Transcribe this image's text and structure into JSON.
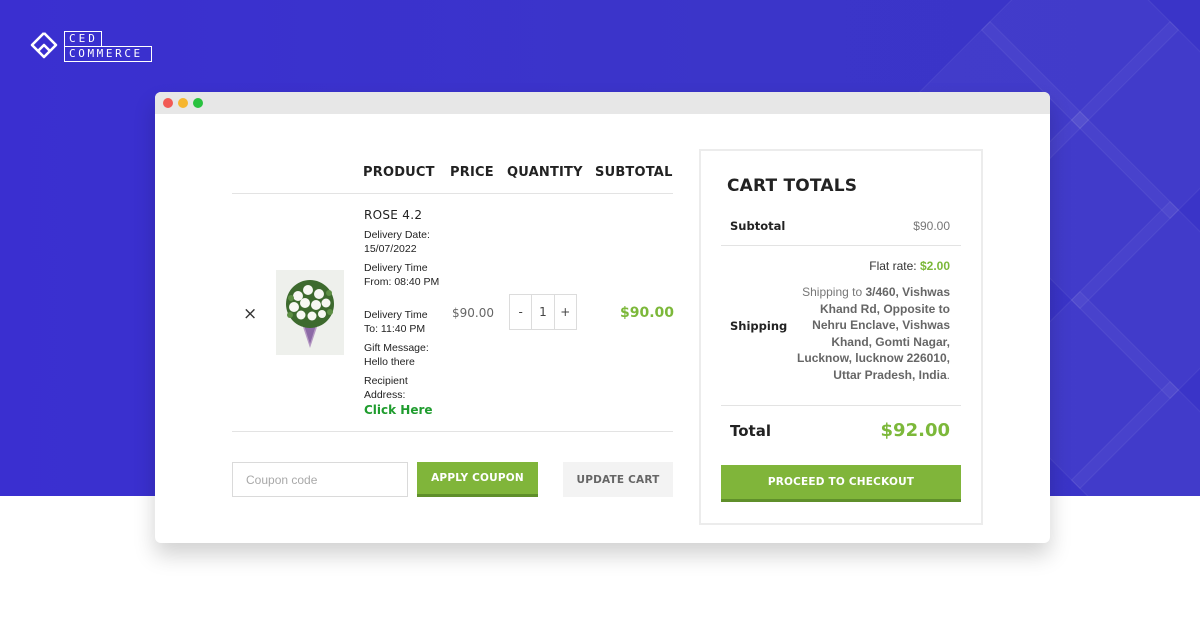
{
  "brand": {
    "line1": "CED",
    "line2": "COMMERCE"
  },
  "cart": {
    "headers": {
      "product": "PRODUCT",
      "price": "PRICE",
      "quantity": "QUANTITY",
      "subtotal": "SUBTOTAL"
    },
    "item": {
      "remove_symbol": "×",
      "name": "ROSE 4.2",
      "delivery_date": "Delivery Date: 15/07/2022",
      "delivery_from": "Delivery Time From: 08:40 PM",
      "delivery_to": "Delivery Time To: 11:40 PM",
      "gift_message": "Gift Message: Hello there",
      "recipient": "Recipient Address:",
      "recipient_link": "Click Here",
      "price": "$90.00",
      "quantity": "1",
      "qty_minus": "-",
      "qty_plus": "+",
      "subtotal": "$90.00"
    },
    "coupon_placeholder": "Coupon code",
    "apply_coupon": "APPLY COUPON",
    "update_cart": "UPDATE CART"
  },
  "totals": {
    "title": "CART TOTALS",
    "subtotal_label": "Subtotal",
    "subtotal_value": "$90.00",
    "shipping_label": "Shipping",
    "flat_rate_label": "Flat rate:",
    "flat_rate_value": "$2.00",
    "shipping_to": "Shipping to",
    "shipping_address": "3/460, Vishwas Khand Rd, Opposite to Nehru Enclave, Vishwas Khand, Gomti Nagar, Lucknow, lucknow 226010, Uttar Pradesh, India",
    "total_label": "Total",
    "total_value": "$92.00",
    "checkout": "PROCEED TO CHECKOUT"
  },
  "colors": {
    "background": "#3a2fd0",
    "accent_green": "#80b53a",
    "price_green": "#7cb83a",
    "link_green": "#1f9c2e"
  }
}
